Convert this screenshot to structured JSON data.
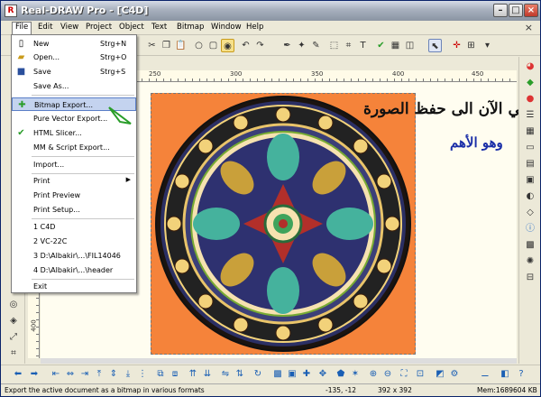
{
  "window": {
    "title": "Real-DRAW Pro - [C4D]",
    "app_icon_glyph": "R"
  },
  "menubar": {
    "items": [
      "File",
      "Edit",
      "View",
      "Project",
      "Object",
      "Text",
      "Bitmap",
      "Window",
      "Help"
    ]
  },
  "file_menu": {
    "items": [
      {
        "label": "New",
        "shortcut": "Strg+N",
        "icon": "new-doc-icon"
      },
      {
        "label": "Open...",
        "shortcut": "Strg+O",
        "icon": "open-folder-icon"
      },
      {
        "label": "Save",
        "shortcut": "Strg+S",
        "icon": "save-icon"
      },
      {
        "label": "Save As...",
        "shortcut": "",
        "icon": ""
      },
      {
        "label": "Bitmap Export...",
        "shortcut": "",
        "icon": "bitmap-export-icon"
      },
      {
        "label": "Pure Vector Export...",
        "shortcut": "",
        "icon": ""
      },
      {
        "label": "HTML Slicer...",
        "shortcut": "",
        "icon": "html-slicer-icon"
      },
      {
        "label": "MM & Script Export...",
        "shortcut": "",
        "icon": ""
      },
      {
        "label": "Import...",
        "shortcut": "",
        "icon": ""
      },
      {
        "label": "Print",
        "shortcut": "",
        "icon": ""
      },
      {
        "label": "Print Preview",
        "shortcut": "",
        "icon": ""
      },
      {
        "label": "Print Setup...",
        "shortcut": "",
        "icon": ""
      },
      {
        "label": "1 C4D",
        "shortcut": "",
        "icon": ""
      },
      {
        "label": "2 VC-22C",
        "shortcut": "",
        "icon": ""
      },
      {
        "label": "3 D:\\Albakir\\...\\FIL14046",
        "shortcut": "",
        "icon": ""
      },
      {
        "label": "4 D:\\Albakir\\...\\header",
        "shortcut": "",
        "icon": ""
      },
      {
        "label": "Exit",
        "shortcut": "",
        "icon": ""
      }
    ]
  },
  "ruler": {
    "top_labels": [
      "200",
      "250",
      "300",
      "350",
      "400",
      "450"
    ],
    "left_labels": [
      "350",
      "400"
    ]
  },
  "annotation": {
    "line1": "نأتي الآن الى حفظ الصورة",
    "line2": "وهو الأهم"
  },
  "statusbar": {
    "message": "Export the active document as a bitmap in various formats",
    "coords": "-135, -12",
    "size": "392 x 392",
    "memory": "Mem:1689604 KB"
  },
  "colors": {
    "artwork_bg": "#f5833a",
    "highlight": "#c4d3ef",
    "arabic_blue": "#1b2fa8"
  }
}
